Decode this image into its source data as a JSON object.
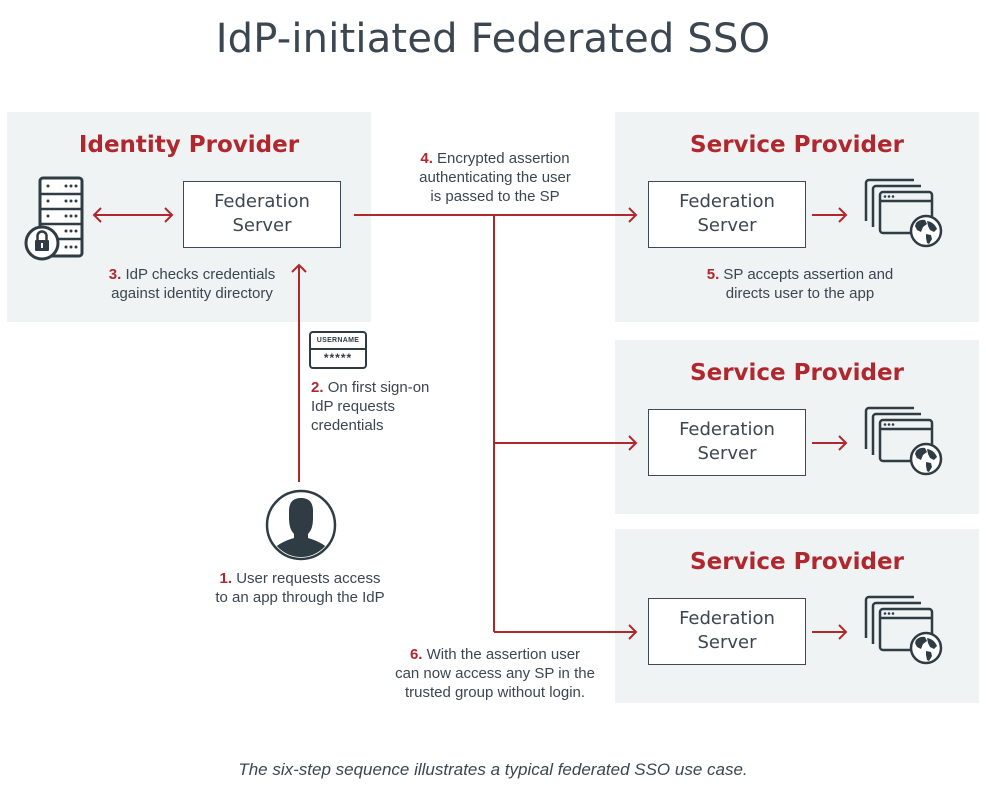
{
  "title": "IdP-initiated Federated SSO",
  "colors": {
    "accent": "#b1272e",
    "panel_bg": "#eff3f4",
    "text": "#3b4650",
    "icon": "#2f3c44"
  },
  "identity_provider": {
    "heading": "Identity Provider",
    "server_line1": "Federation",
    "server_line2": "Server",
    "icon": "server-rack-lock-icon",
    "step3": {
      "num": "3.",
      "line1": "IdP checks credentials",
      "line2": "against identity directory"
    }
  },
  "service_providers": [
    {
      "heading": "Service Provider",
      "server_line1": "Federation",
      "server_line2": "Server",
      "icon": "browser-windows-globe-icon",
      "step5": {
        "num": "5.",
        "line1": "SP accepts assertion and",
        "line2": "directs user to the app"
      }
    },
    {
      "heading": "Service Provider",
      "server_line1": "Federation",
      "server_line2": "Server",
      "icon": "browser-windows-globe-icon"
    },
    {
      "heading": "Service Provider",
      "server_line1": "Federation",
      "server_line2": "Server",
      "icon": "browser-windows-globe-icon"
    }
  ],
  "credentials_card": {
    "label": "USERNAME",
    "password": "*****",
    "icon": "credentials-card-icon"
  },
  "steps": {
    "step1": {
      "num": "1.",
      "line1": "User requests access",
      "line2": "to an app through the IdP"
    },
    "step2": {
      "num": "2.",
      "line1": "On first sign-on",
      "line2": "IdP requests",
      "line3": "credentials"
    },
    "step4": {
      "num": "4.",
      "line1": "Encrypted assertion",
      "line2": "authenticating the user",
      "line3": "is passed to the SP"
    },
    "step6": {
      "num": "6.",
      "line1": "With the assertion user",
      "line2": "can now access any SP in the",
      "line3": "trusted group without login."
    }
  },
  "user_icon": "user-avatar-icon",
  "caption": "The six-step sequence illustrates a typical federated SSO use case."
}
